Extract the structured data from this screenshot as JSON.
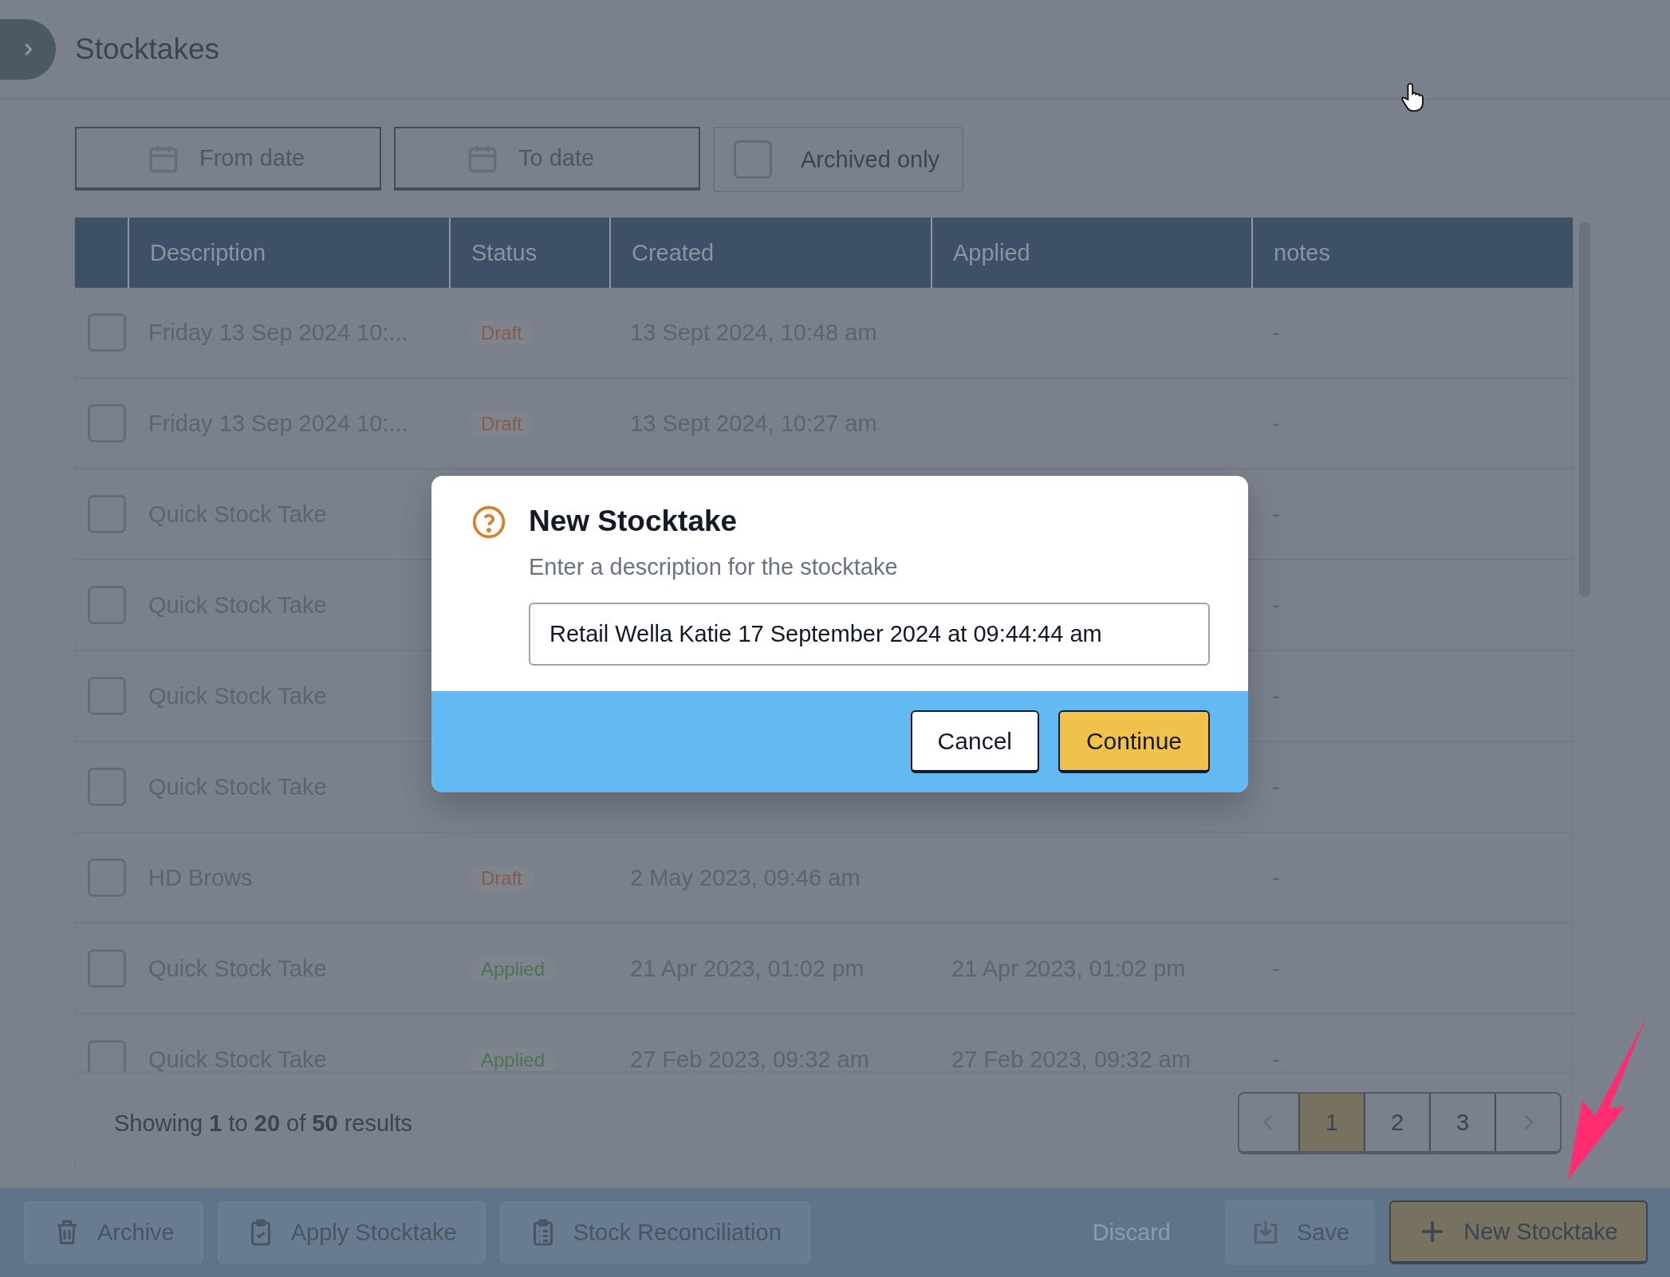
{
  "header": {
    "title": "Stocktakes"
  },
  "filters": {
    "from_date": {
      "placeholder": "From date"
    },
    "to_date": {
      "placeholder": "To date"
    },
    "archived_only": {
      "label": "Archived only",
      "checked": false
    }
  },
  "table": {
    "columns": [
      "Description",
      "Status",
      "Created",
      "Applied",
      "notes"
    ],
    "rows": [
      {
        "checked": false,
        "description": "Friday 13 Sep 2024 10:...",
        "status": {
          "kind": "draft",
          "label": "Draft"
        },
        "created": "13 Sept 2024, 10:48 am",
        "notes": "-"
      },
      {
        "checked": false,
        "description": "Friday 13 Sep 2024 10:...",
        "status": {
          "kind": "draft",
          "label": "Draft"
        },
        "created": "13 Sept 2024, 10:27 am",
        "notes": "-"
      },
      {
        "checked": false,
        "description": "Quick Stock Take",
        "notes": "-"
      },
      {
        "checked": false,
        "description": "Quick Stock Take",
        "notes": "-"
      },
      {
        "checked": false,
        "description": "Quick Stock Take",
        "notes": "-"
      },
      {
        "checked": false,
        "description": "Quick Stock Take",
        "notes": "-"
      },
      {
        "checked": false,
        "description": "HD Brows",
        "status": {
          "kind": "draft",
          "label": "Draft"
        },
        "created": "2 May 2023, 09:46 am",
        "notes": "-"
      },
      {
        "checked": false,
        "description": "Quick Stock Take",
        "status": {
          "kind": "applied",
          "label": "Applied"
        },
        "created": "21 Apr 2023, 01:02 pm",
        "applied": "21 Apr 2023, 01:02 pm",
        "notes": "-"
      },
      {
        "checked": false,
        "description": "Quick Stock Take",
        "status": {
          "kind": "applied",
          "label": "Applied"
        },
        "created": "27 Feb 2023, 09:32 am",
        "applied": "27 Feb 2023, 09:32 am",
        "notes": "-"
      }
    ]
  },
  "results_summary": "Showing **1** to **20** of **50** results",
  "pagination": [
    {
      "label": "1",
      "selected": true
    },
    {
      "label": "2",
      "selected": false
    },
    {
      "label": "3",
      "selected": false
    }
  ],
  "action_bar": {
    "left": [
      {
        "kind": "trash",
        "label": "Archive"
      },
      {
        "kind": "clipboard-check",
        "label": "Apply Stocktake"
      },
      {
        "kind": "clipboard-list",
        "label": "Stock Reconciliation"
      }
    ],
    "discard": {
      "label": "Discard",
      "disabled": true
    },
    "save": {
      "label": "Save",
      "disabled": true
    },
    "new": {
      "label": "New Stocktake"
    }
  },
  "dialog": {
    "title": "New Stocktake",
    "message": "Enter a description for the stocktake",
    "input": {
      "value": "Retail Wella Katie 17 September 2024 at 09:44:44 am"
    },
    "buttons": [
      {
        "kind": "secondary",
        "label": "Cancel"
      },
      {
        "kind": "primary",
        "label": "Continue"
      }
    ]
  }
}
